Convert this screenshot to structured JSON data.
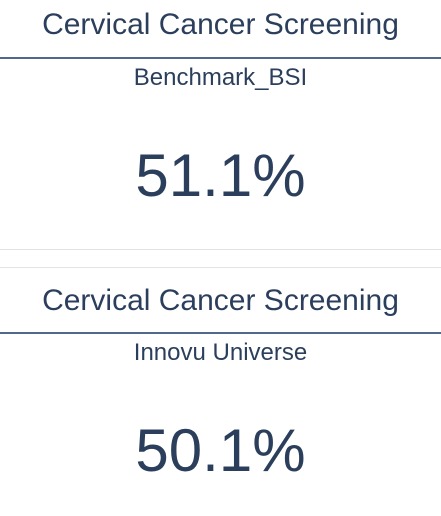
{
  "cards": [
    {
      "title": "Cervical Cancer Screening",
      "subtitle": "Benchmark_BSI",
      "value": "51.1%"
    },
    {
      "title": "Cervical Cancer Screening",
      "subtitle": "Innovu Universe",
      "value": "50.1%"
    }
  ],
  "colors": {
    "text": "#2b3f5c",
    "rule": "#52688a",
    "separator": "#e3e3e3",
    "background": "#ffffff"
  }
}
